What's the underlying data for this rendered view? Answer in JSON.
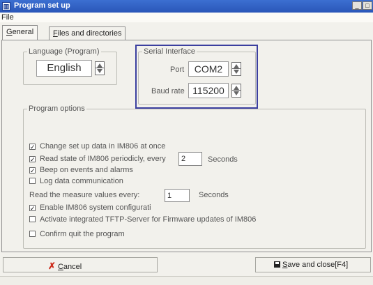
{
  "window": {
    "title": "Program set up",
    "minimize": "_",
    "maximize": "□"
  },
  "menu": {
    "file": "File"
  },
  "tabs": [
    {
      "label_accel": "G",
      "label_rest": "eneral"
    },
    {
      "label_accel": "F",
      "label_rest": "iles and directories"
    }
  ],
  "language": {
    "legend": "Language (Program)",
    "value": "English"
  },
  "serial": {
    "legend": "Serial Interface",
    "port_label": "Port",
    "port_value": "COM2",
    "baud_label": "Baud rate",
    "baud_value": "115200"
  },
  "options": {
    "legend": "Program options",
    "change_setup": {
      "label": "Change set up data in IM806 at once",
      "checked": true
    },
    "read_state": {
      "label": "Read state of IM806 periodicly, every",
      "checked": true,
      "interval": "2",
      "unit": "Seconds"
    },
    "beep": {
      "label": "Beep on events and alarms",
      "checked": true
    },
    "log": {
      "label": "Log data communication",
      "checked": false
    },
    "measure": {
      "label": "Read the measure values every:",
      "interval": "1",
      "unit": "Seconds"
    },
    "enable_config": {
      "label": "Enable IM806 system configurati",
      "checked": true
    },
    "tftp": {
      "label": "Activate integrated TFTP-Server for Firmware updates of IM806",
      "checked": false
    },
    "confirm_quit": {
      "label": "Confirm quit the program",
      "checked": false
    }
  },
  "buttons": {
    "cancel_accel": "C",
    "cancel_rest": "ancel",
    "save_accel": "S",
    "save_rest": "ave and close[F4]"
  },
  "colors": {
    "titlebar": "#2a56b8",
    "highlight": "#3b3f9f",
    "cancel_icon": "#cc2a1a"
  }
}
